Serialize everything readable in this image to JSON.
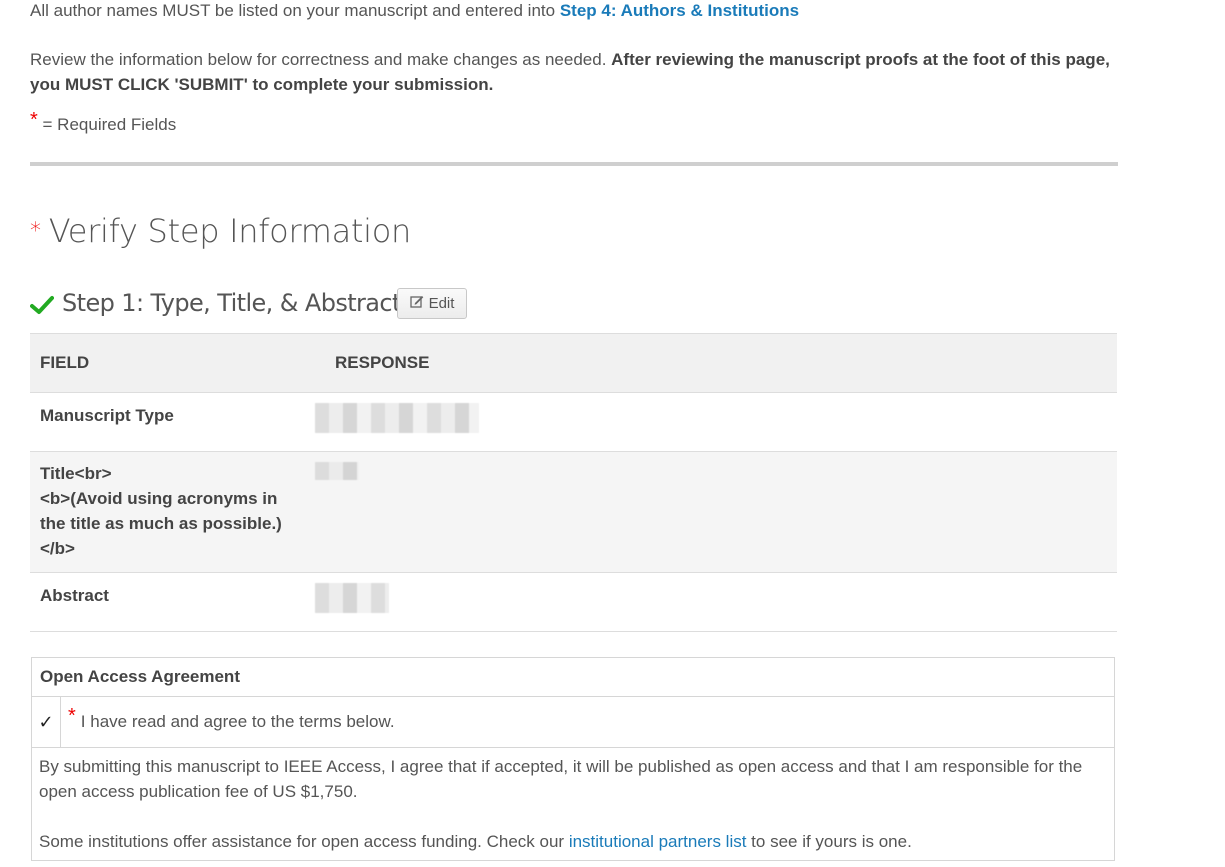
{
  "intro": {
    "authors_prefix": "All author names MUST be listed on your manuscript and entered into ",
    "authors_link": "Step 4: Authors & Institutions",
    "review_text": "Review the information below for correctness and make changes as needed. ",
    "review_bold": "After reviewing the manuscript proofs at the foot of this page, you MUST CLICK 'SUBMIT' to complete your submission.",
    "required_star": "*",
    "required_label": "= Required Fields"
  },
  "verify": {
    "star": "*",
    "title": "Verify Step Information"
  },
  "step1": {
    "title": "Step 1: Type, Title, & Abstract",
    "edit_label": "Edit"
  },
  "table": {
    "headers": [
      "FIELD",
      "RESPONSE"
    ],
    "rows": [
      {
        "field": "Manuscript Type"
      },
      {
        "field_lines": [
          "Title<br>",
          "<b>(Avoid using acronyms in",
          "the title as much as possible.)",
          "</b>"
        ]
      },
      {
        "field": "Abstract"
      }
    ]
  },
  "open_access": {
    "heading": "Open Access Agreement",
    "check_mark": "✓",
    "agree_star": "*",
    "agree_text": "I have read and agree to the terms below.",
    "para1": "By submitting this manuscript to IEEE Access, I agree that if accepted, it will be published as open access and that I am responsible for the open access publication fee of US $1,750.",
    "para2_prefix": "Some institutions offer assistance for open access funding. Check our ",
    "para2_link": "institutional partners list",
    "para2_suffix": " to see if yours is one."
  },
  "colors": {
    "link": "#1a7bb9",
    "required": "#e00000",
    "check": "#22aa22"
  }
}
